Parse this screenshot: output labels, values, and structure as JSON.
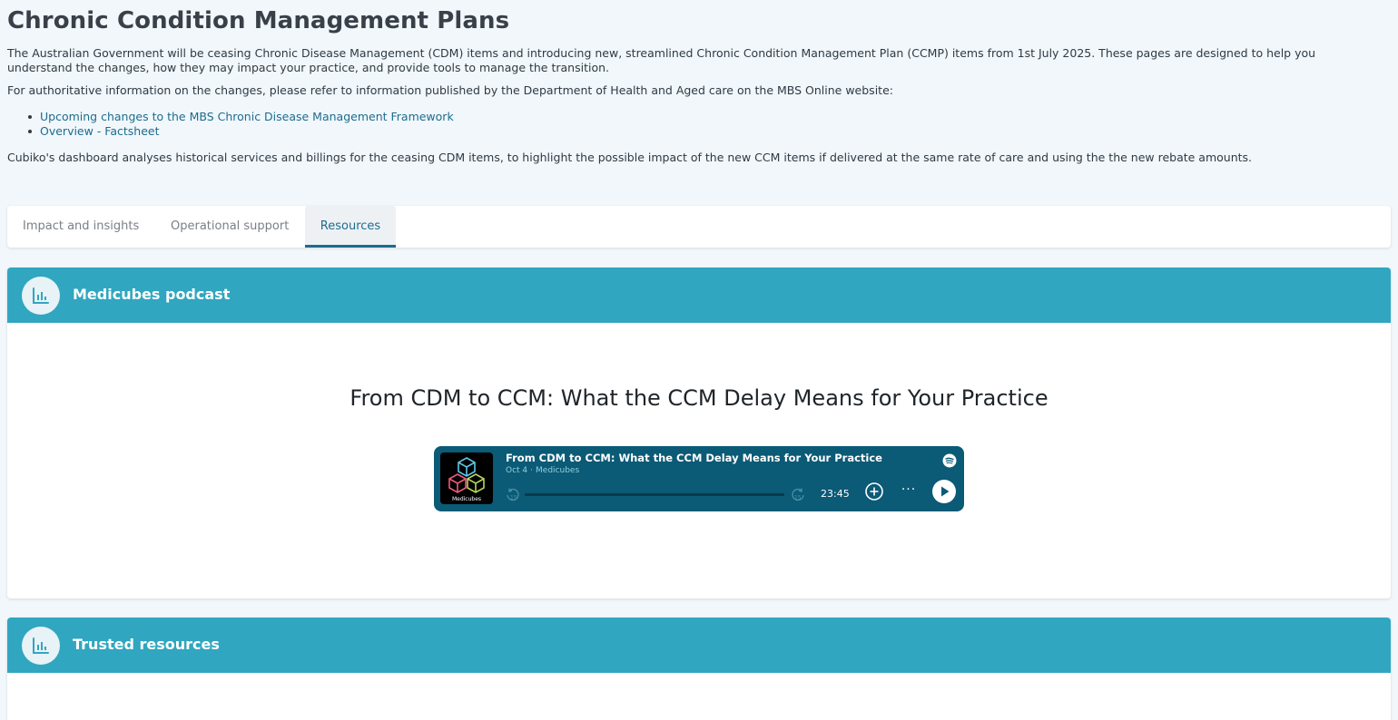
{
  "page": {
    "title": "Chronic Condition Management Plans",
    "intro": "The Australian Government will be ceasing Chronic Disease Management (CDM) items and introducing new, streamlined Chronic Condition Management Plan (CCMP) items from 1st July 2025. These pages are designed to help you understand the changes, how they may impact your practice, and provide tools to manage the transition.",
    "authoritative": "For authoritative information on the changes, please refer to information published by the Department of Health and Aged care on the MBS Online website:",
    "links": [
      {
        "label": "Upcoming changes to the MBS Chronic Disease Management Framework"
      },
      {
        "label": "Overview - Factsheet"
      }
    ],
    "dashboard_note": "Cubiko's dashboard analyses historical services and billings for the ceasing CDM items, to highlight the possible impact of the new CCM items if delivered at the same rate of care and using the the new rebate amounts."
  },
  "tabs": [
    {
      "label": "Impact and insights",
      "active": false
    },
    {
      "label": "Operational support",
      "active": false
    },
    {
      "label": "Resources",
      "active": true
    }
  ],
  "podcast_panel": {
    "title": "Medicubes podcast",
    "icon": "bar-chart-icon",
    "episode_heading": "From CDM to CCM: What the CCM Delay Means for Your Practice",
    "player": {
      "cover_label": "Medicubes",
      "title": "From CDM to CCM: What the CCM Delay Means for Your Practice",
      "date": "Oct 4",
      "separator": "·",
      "show": "Medicubes",
      "duration": "23:45",
      "progress": 0.0,
      "skip_back_label": "15",
      "skip_forward_label": "15",
      "more_label": "···"
    }
  },
  "resources_panel": {
    "title": "Trusted resources",
    "icon": "bar-chart-icon"
  },
  "colors": {
    "accent": "#31a6c0",
    "link": "#1d6c8e",
    "player_bg": "#0b5a76",
    "page_bg": "#f1f7fb"
  }
}
